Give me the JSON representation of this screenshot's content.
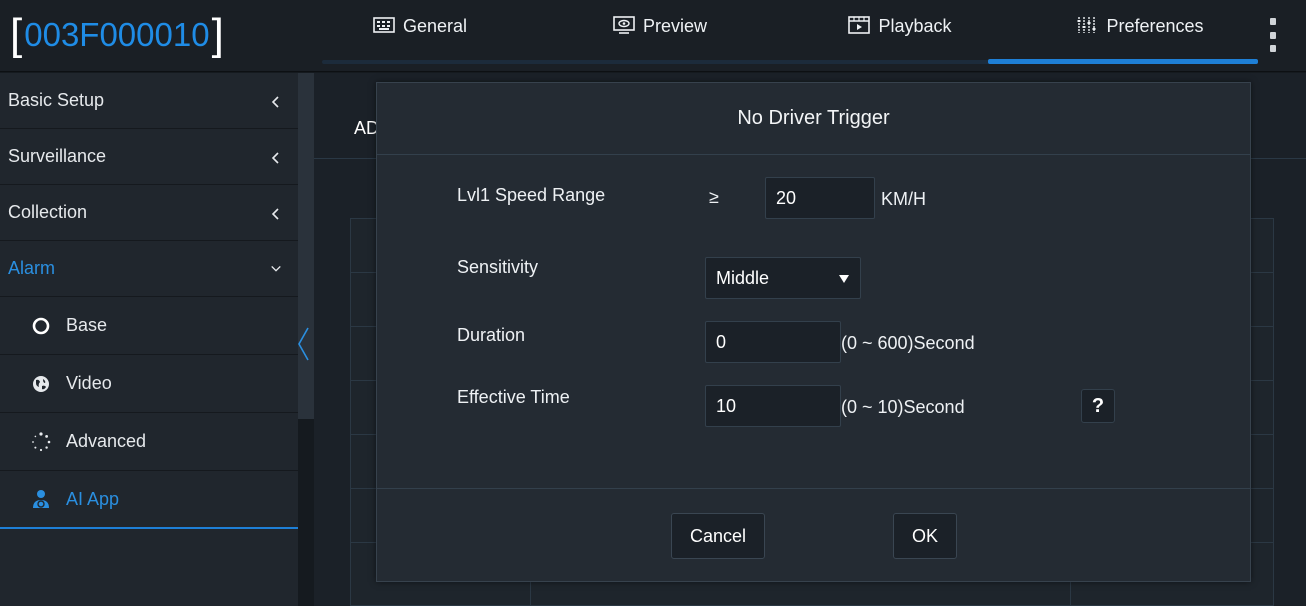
{
  "header": {
    "device_id": "003F000010",
    "tabs": [
      {
        "label": "General",
        "icon": "keyboard-icon"
      },
      {
        "label": "Preview",
        "icon": "monitor-eye-icon"
      },
      {
        "label": "Playback",
        "icon": "film-play-icon"
      },
      {
        "label": "Preferences",
        "icon": "sliders-icon"
      }
    ],
    "active_tab": "Preferences"
  },
  "sidebar": {
    "items": [
      {
        "label": "Basic Setup"
      },
      {
        "label": "Surveillance"
      },
      {
        "label": "Collection"
      },
      {
        "label": "Alarm"
      }
    ],
    "sub_items": [
      {
        "label": "Base",
        "icon": "circle-icon"
      },
      {
        "label": "Video",
        "icon": "globe-icon"
      },
      {
        "label": "Advanced",
        "icon": "spinner-dots-icon"
      },
      {
        "label": "AI App",
        "icon": "driver-icon"
      }
    ]
  },
  "content": {
    "tab_fragment": "AD"
  },
  "modal": {
    "title": "No Driver Trigger",
    "speed": {
      "label": "Lvl1 Speed Range",
      "operator": "≥",
      "value": "20",
      "unit": "KM/H"
    },
    "sensitivity": {
      "label": "Sensitivity",
      "value": "Middle"
    },
    "duration": {
      "label": "Duration",
      "value": "0",
      "unit": "(0 ~ 600)Second"
    },
    "effective_time": {
      "label": "Effective Time",
      "value": "10",
      "unit": "(0 ~ 10)Second"
    },
    "help_label": "?",
    "cancel_label": "Cancel",
    "ok_label": "OK"
  },
  "colors": {
    "accent": "#1e7fd6",
    "background": "#151a1f",
    "panel": "#242b33"
  }
}
